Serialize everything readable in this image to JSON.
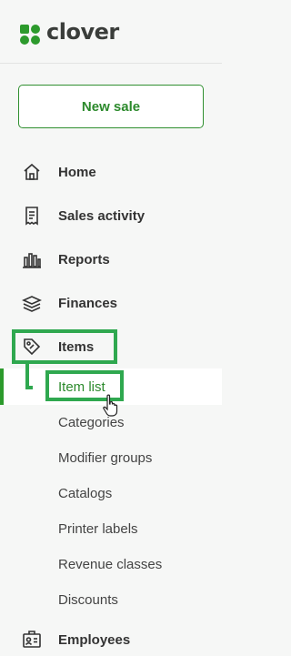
{
  "brand": {
    "name": "clover",
    "color": "#2c8a2c"
  },
  "new_sale_label": "New sale",
  "nav": {
    "home": "Home",
    "sales_activity": "Sales activity",
    "reports": "Reports",
    "finances": "Finances",
    "items": "Items",
    "employees": "Employees"
  },
  "items_submenu": [
    {
      "label": "Item list",
      "active": true
    },
    {
      "label": "Categories"
    },
    {
      "label": "Modifier groups"
    },
    {
      "label": "Catalogs"
    },
    {
      "label": "Printer labels"
    },
    {
      "label": "Revenue classes"
    },
    {
      "label": "Discounts"
    }
  ],
  "icons": {
    "home": "home-icon",
    "sales_activity": "receipt-icon",
    "reports": "bar-chart-icon",
    "finances": "stack-icon",
    "items": "tag-icon",
    "employees": "id-badge-icon"
  },
  "highlight_color": "#2fa84f"
}
